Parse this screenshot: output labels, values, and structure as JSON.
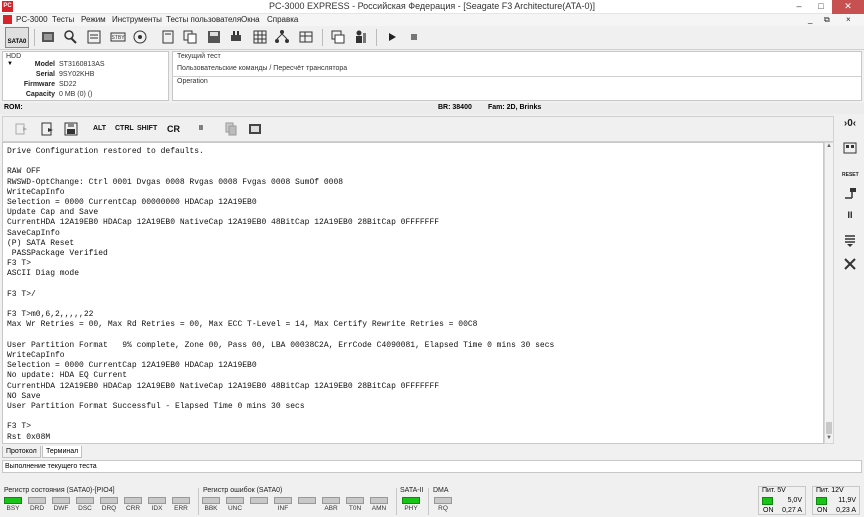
{
  "window": {
    "title": "PC-3000 EXPRESS - Российская Федерация - [Seagate F3 Architecture(ATA-0)]",
    "logo_text": "PC",
    "minimize": "–",
    "maximize": "□",
    "close": "✕"
  },
  "menu": {
    "items": [
      "PC-3000",
      "Тесты",
      "Режим",
      "Инструменты",
      "Тесты пользователя",
      "Окна",
      "Справка"
    ],
    "right_minimize": "_",
    "right_restore": "⧉",
    "right_close": "×"
  },
  "toolbar": {
    "sata_label": "SATA0"
  },
  "hdd": {
    "title": "HDD",
    "rows": [
      {
        "label": "Model",
        "value": "ST3160813AS"
      },
      {
        "label": "Serial",
        "value": "9SY02KHB"
      },
      {
        "label": "Firmware",
        "value": "SD22"
      },
      {
        "label": "Capacity",
        "value": "0 MB (0) ()"
      }
    ]
  },
  "current_test": {
    "title": "Текущий тест",
    "value": "Пользовательские команды / Пересчёт транслятора",
    "operation_title": "Operation"
  },
  "rom": {
    "label": "ROM:",
    "br": "BR: 38400",
    "fam": "Fam: 2D, Brinks"
  },
  "terminal_toolbar": {
    "alt": "ALT",
    "ctrl": "CTRL",
    "shift": "SHIFT",
    "cr": "CR",
    "pause": "II"
  },
  "terminal": {
    "lines": [
      "Drive Configuration restored to defaults.",
      "",
      "RAW OFF",
      "RWSWD-OptChange: Ctrl 0001 Dvgas 0008 Rvgas 0008 Fvgas 0008 SumOf 0008",
      "WriteCapInfo",
      "Selection = 0000 CurrentCap 00000000 HDACap 12A19EB0",
      "Update Cap and Save",
      "CurrentHDA 12A19EB0 HDACap 12A19EB0 NativeCap 12A19EB0 48BitCap 12A19EB0 28BitCap 0FFFFFFF",
      "SaveCapInfo",
      "(P) SATA Reset",
      " PASSPackage Verified",
      "F3 T>",
      "ASCII Diag mode",
      "",
      "F3 T>/",
      "",
      "F3 T>m0,6,2,,,,,22",
      "Max Wr Retries = 00, Max Rd Retries = 00, Max ECC T-Level = 14, Max Certify Rewrite Retries = 00C8",
      "",
      "User Partition Format   9% complete, Zone 00, Pass 00, LBA 00038C2A, ErrCode C4090081, Elapsed Time 0 mins 30 secs",
      "WriteCapInfo",
      "Selection = 0000 CurrentCap 12A19EB0 HDACap 12A19EB0",
      "No update: HDA EQ Current",
      "CurrentHDA 12A19EB0 HDACap 12A19EB0 NativeCap 12A19EB0 48BitCap 12A19EB0 28BitCap 0FFFFFFF",
      "NO Save",
      "User Partition Format Successful - Elapsed Time 0 mins 30 secs",
      "",
      "F3 T>",
      "Rst 0x08M"
    ]
  },
  "side_toolbar": {
    "reset_label": "RESET",
    "pause": "II",
    "zero_label": "›0‹"
  },
  "tabs": [
    "Протокол",
    "Терминал"
  ],
  "status": {
    "text": "Выполнение текущего теста"
  },
  "registers": {
    "state_title": "Регистр состояния (SATA0)-[PIO4]",
    "state_flags": [
      {
        "name": "BSY",
        "on": true
      },
      {
        "name": "DRD",
        "on": false
      },
      {
        "name": "DWF",
        "on": false
      },
      {
        "name": "DSC",
        "on": false
      },
      {
        "name": "DRQ",
        "on": false
      },
      {
        "name": "CRR",
        "on": false
      },
      {
        "name": "IDX",
        "on": false
      },
      {
        "name": "ERR",
        "on": false
      }
    ],
    "error_title": "Регистр ошибок  (SATA0)",
    "error_flags": [
      {
        "name": "BBK",
        "on": false
      },
      {
        "name": "UNC",
        "on": false
      },
      {
        "name": "",
        "on": false
      },
      {
        "name": "INF",
        "on": false
      },
      {
        "name": "",
        "on": false
      },
      {
        "name": "ABR",
        "on": false
      },
      {
        "name": "T0N",
        "on": false
      },
      {
        "name": "AMN",
        "on": false
      }
    ],
    "sata_title": "SATA-II",
    "sata_flags": [
      {
        "name": "PHY",
        "on": true
      }
    ],
    "dma_title": "DMA",
    "dma_flags": [
      {
        "name": "RQ",
        "on": false
      }
    ]
  },
  "power": {
    "p5": {
      "title": "Пит. 5V",
      "volt": "5,0V",
      "on": "ON",
      "amp": "0,27 A"
    },
    "p12": {
      "title": "Пит. 12V",
      "volt": "11,9V",
      "on": "ON",
      "amp": "0,23 A"
    }
  }
}
